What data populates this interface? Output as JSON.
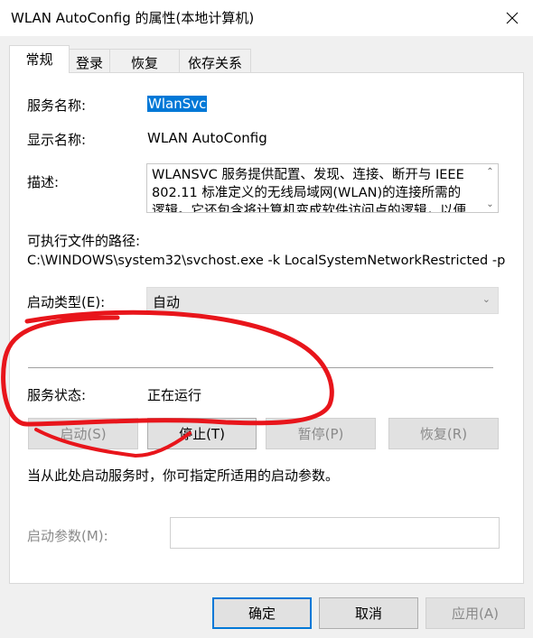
{
  "window": {
    "title": "WLAN AutoConfig 的属性(本地计算机)",
    "close_icon": "close-icon"
  },
  "tabs": [
    {
      "label": "常规",
      "active": true
    },
    {
      "label": "登录",
      "active": false
    },
    {
      "label": "恢复",
      "active": false
    },
    {
      "label": "依存关系",
      "active": false
    }
  ],
  "general": {
    "service_name_label": "服务名称:",
    "service_name_value": "WlanSvc",
    "display_name_label": "显示名称:",
    "display_name_value": "WLAN AutoConfig",
    "description_label": "描述:",
    "description_value": "WLANSVC 服务提供配置、发现、连接、断开与 IEEE 802.11 标准定义的无线局域网(WLAN)的连接所需的逻辑。它还包含将计算机变成软件访问点的逻辑，以便",
    "path_label": "可执行文件的路径:",
    "path_value": "C:\\WINDOWS\\system32\\svchost.exe -k LocalSystemNetworkRestricted -p",
    "startup_type_label": "启动类型(E):",
    "startup_type_value": "自动",
    "status_label": "服务状态:",
    "status_value": "正在运行",
    "buttons": {
      "start": "启动(S)",
      "stop": "停止(T)",
      "pause": "暂停(P)",
      "resume": "恢复(R)"
    },
    "hint_text": "当从此处启动服务时，你可指定所适用的启动参数。",
    "start_params_label": "启动参数(M):",
    "start_params_value": ""
  },
  "dialog_buttons": {
    "ok": "确定",
    "cancel": "取消",
    "apply": "应用(A)"
  },
  "colors": {
    "annotation_red": "#e8151b",
    "selection_blue": "#0078d7"
  }
}
